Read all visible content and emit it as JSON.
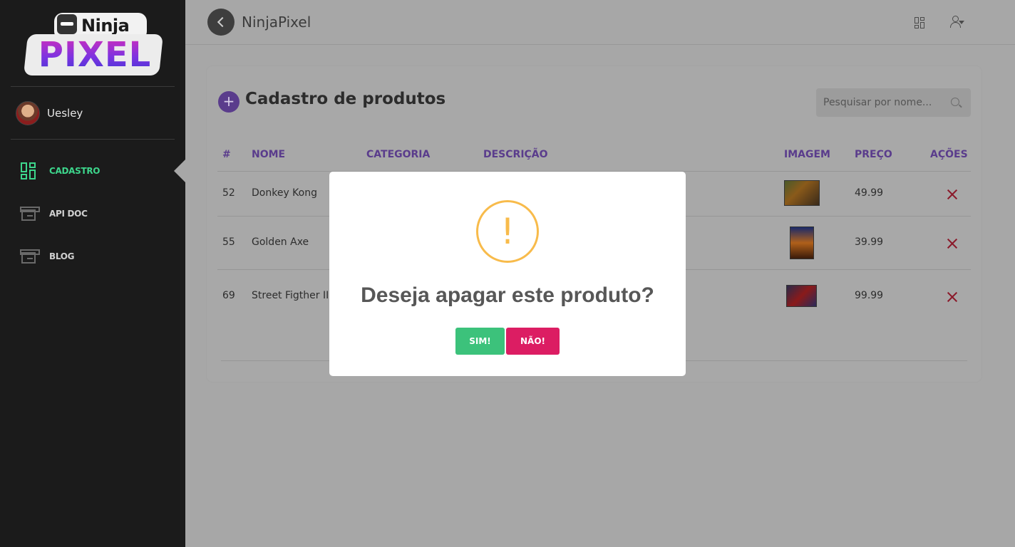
{
  "app": {
    "title": "NinjaPixel"
  },
  "logo": {
    "top": "Ninja",
    "bottom": "PIXEL"
  },
  "user": {
    "name": "Uesley"
  },
  "sidebar": {
    "items": [
      {
        "label": "CADASTRO",
        "icon": "dashboard-icon",
        "active": true
      },
      {
        "label": "API DOC",
        "icon": "archive-box-icon",
        "active": false
      },
      {
        "label": "BLOG",
        "icon": "archive-box-icon",
        "active": false
      }
    ]
  },
  "header": {
    "title": "NinjaPixel"
  },
  "page": {
    "title": "Cadastro de produtos",
    "add_label": "+",
    "search_placeholder": "Pesquisar por nome..."
  },
  "table": {
    "columns": [
      "#",
      "NOME",
      "CATEGORIA",
      "DESCRIÇÃO",
      "IMAGEM",
      "PREÇO",
      "AÇÕES"
    ],
    "rows": [
      {
        "id": "52",
        "name": "Donkey Kong",
        "price": "49.99"
      },
      {
        "id": "55",
        "name": "Golden Axe",
        "price": "39.99"
      },
      {
        "id": "69",
        "name": "Street Figther II",
        "price": "99.99"
      }
    ]
  },
  "modal": {
    "icon": "!",
    "title": "Deseja apagar este produto?",
    "confirm_label": "SIM!",
    "cancel_label": "NÃO!"
  },
  "colors": {
    "accent": "#5a3c8c",
    "active": "#3dd68c",
    "warning": "#f8bb4b",
    "confirm": "#3cc27b",
    "cancel": "#dc1d63"
  }
}
